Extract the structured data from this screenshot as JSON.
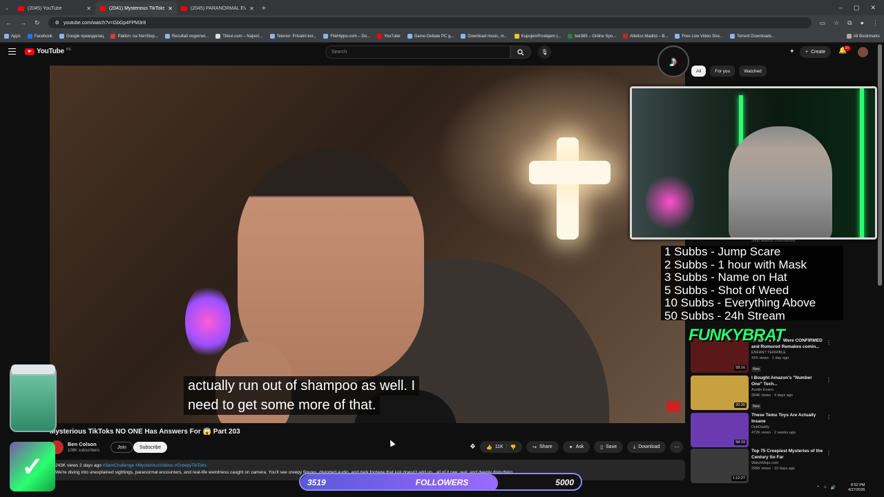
{
  "browser": {
    "tabs": [
      {
        "label": "(2045) YouTube",
        "active": false
      },
      {
        "label": "(2041) Mysterious TikToks N",
        "active": true
      },
      {
        "label": "(2045) PARANORMAL EVIDENC",
        "active": false
      }
    ],
    "new_tab": "+",
    "window_controls": [
      "–",
      "▢",
      "✕"
    ],
    "url": "youtube.com/watch?v=GbGp4FPM3r8",
    "bookmarks": [
      "Apps",
      "Facebook",
      "Google преводилац",
      "Paklon: na NonStop...",
      "Rezultati nogomet...",
      "Titlovi.com – Najveć...",
      "Telenor: Privatni kor...",
      "FileHippo.com – Do...",
      "YouTube",
      "Game-Debate PC g...",
      "Download music, m...",
      "KupujemProdajem |...",
      "bet365 – Online Spo...",
      "Atletico Madrid – B...",
      "Free Live Video Stre...",
      "Torrent Downloads..."
    ],
    "all_bookmarks": "All Bookmarks"
  },
  "youtube": {
    "logo_text": "YouTube",
    "logo_country": "RS",
    "search_placeholder": "Search",
    "create_label": "Create",
    "notif_count": "9+",
    "chips": [
      "All",
      "For you",
      "Watched"
    ]
  },
  "video": {
    "subtitle_lines": [
      "actually run out of shampoo as well. I",
      "need to get some more of that."
    ],
    "title": "Mysterious TikToks NO ONE Has Answers For 😱 Part 203",
    "channel": "Ben Colson",
    "subscribers": "108K subscribers",
    "join": "Join",
    "subscribe": "Subscribe",
    "likes": "11K",
    "share": "Share",
    "ask": "Ask",
    "save": "Save",
    "download": "Download",
    "more": "⋯",
    "desc_stats": "243K views  2 days ago",
    "desc_tags": "#3amChallenge #MysteriousVideos #CreepyTikToks",
    "desc_text": "We're diving into unexplained sightings, paranormal encounters, and real-life weirdness caught on camera. You'll see creepy figures, distorted audio, and dark footage that just doesn't add up...all of it raw, real, and deeply disturbing."
  },
  "sidebar": {
    "items": [
      {
        "title": "Remakes That Were CONFIRMED and Rumored Remakes comin...",
        "channel": "ENFANT TERRIBLE",
        "meta": "41K views · 1 day ago",
        "badge": "New",
        "duration": "58:16",
        "thumb_color": "#5a1818"
      },
      {
        "title": "I Bought Amazon's \"Number One\" Tech...",
        "channel": "Austin Evans",
        "meta": "394K views · 4 days ago",
        "badge": "New",
        "duration": "20:20",
        "thumb_color": "#c9a040"
      },
      {
        "title": "These Temu Toys Are Actually Insane",
        "channel": "DubDaddy",
        "meta": "472K views · 2 weeks ago",
        "badge": "",
        "duration": "58:33",
        "thumb_color": "#6a3ab0"
      },
      {
        "title": "Top 75 Creepiest Mysteries of the Century So Far",
        "channel": "WatchMojo.com",
        "meta": "295K views · 10 days ago",
        "badge": "",
        "duration": "1:12:27",
        "thumb_color": "#3a3a3a"
      }
    ],
    "partial_channel": "John Malecki Uncensored",
    "partial_title": "Ho..."
  },
  "overlays": {
    "tiktok_glyph": "♪",
    "sub_goals": [
      "1 Subbs - Jump Scare",
      "2 Subbs - 1 hour with Mask",
      "3 Subbs - Name on Hat",
      "5 Subbs - Shot of Weed",
      "10 Subbs - Everything Above",
      "50 Subbs - 24h Stream"
    ],
    "brand_logo": "FUNKYBRAT",
    "followers": {
      "current": "3519",
      "label": "FOLLOWERS",
      "goal": "5000",
      "progress": 0.7038
    },
    "sticker_glyph": "✓"
  },
  "taskbar": {
    "time": "8:52 PM",
    "date": "4/27/2026"
  }
}
